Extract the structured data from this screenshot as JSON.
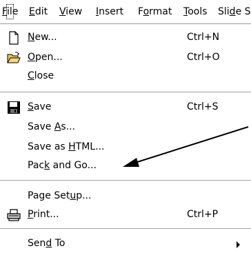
{
  "menubar": {
    "items": [
      {
        "pre": "",
        "u": "F",
        "post": "ile"
      },
      {
        "pre": "",
        "u": "E",
        "post": "dit"
      },
      {
        "pre": "",
        "u": "V",
        "post": "iew"
      },
      {
        "pre": "",
        "u": "I",
        "post": "nsert"
      },
      {
        "pre": "F",
        "u": "o",
        "post": "rmat"
      },
      {
        "pre": "",
        "u": "T",
        "post": "ools"
      },
      {
        "pre": "Sli",
        "u": "d",
        "post": "e S"
      }
    ]
  },
  "file_menu": {
    "new": {
      "pre": "",
      "u": "N",
      "post": "ew...",
      "shortcut": "Ctrl+N"
    },
    "open": {
      "pre": "",
      "u": "O",
      "post": "pen...",
      "shortcut": "Ctrl+O"
    },
    "close": {
      "pre": "",
      "u": "C",
      "post": "lose"
    },
    "save": {
      "pre": "",
      "u": "S",
      "post": "ave",
      "shortcut": "Ctrl+S"
    },
    "save_as": {
      "pre": "Save ",
      "u": "A",
      "post": "s..."
    },
    "save_html": {
      "pre": "Save as ",
      "u": "H",
      "post": "TML..."
    },
    "pack_and_go": {
      "pre": "Pac",
      "u": "k",
      "post": " and Go..."
    },
    "page_setup": {
      "pre": "Page Set",
      "u": "u",
      "post": "p..."
    },
    "print": {
      "pre": "",
      "u": "P",
      "post": "rint...",
      "shortcut": "Ctrl+P"
    },
    "send_to": {
      "pre": "Sen",
      "u": "d",
      "post": " To"
    }
  },
  "icons": {
    "new": "new-document-icon",
    "open": "open-folder-icon",
    "save": "floppy-disk-icon",
    "print": "printer-icon",
    "send_to_arrow": "submenu-arrow-icon",
    "annotation": "annotation-arrow"
  },
  "colors": {
    "background": "#ffffff",
    "separator": "#a0a0a0",
    "text": "#000000"
  }
}
